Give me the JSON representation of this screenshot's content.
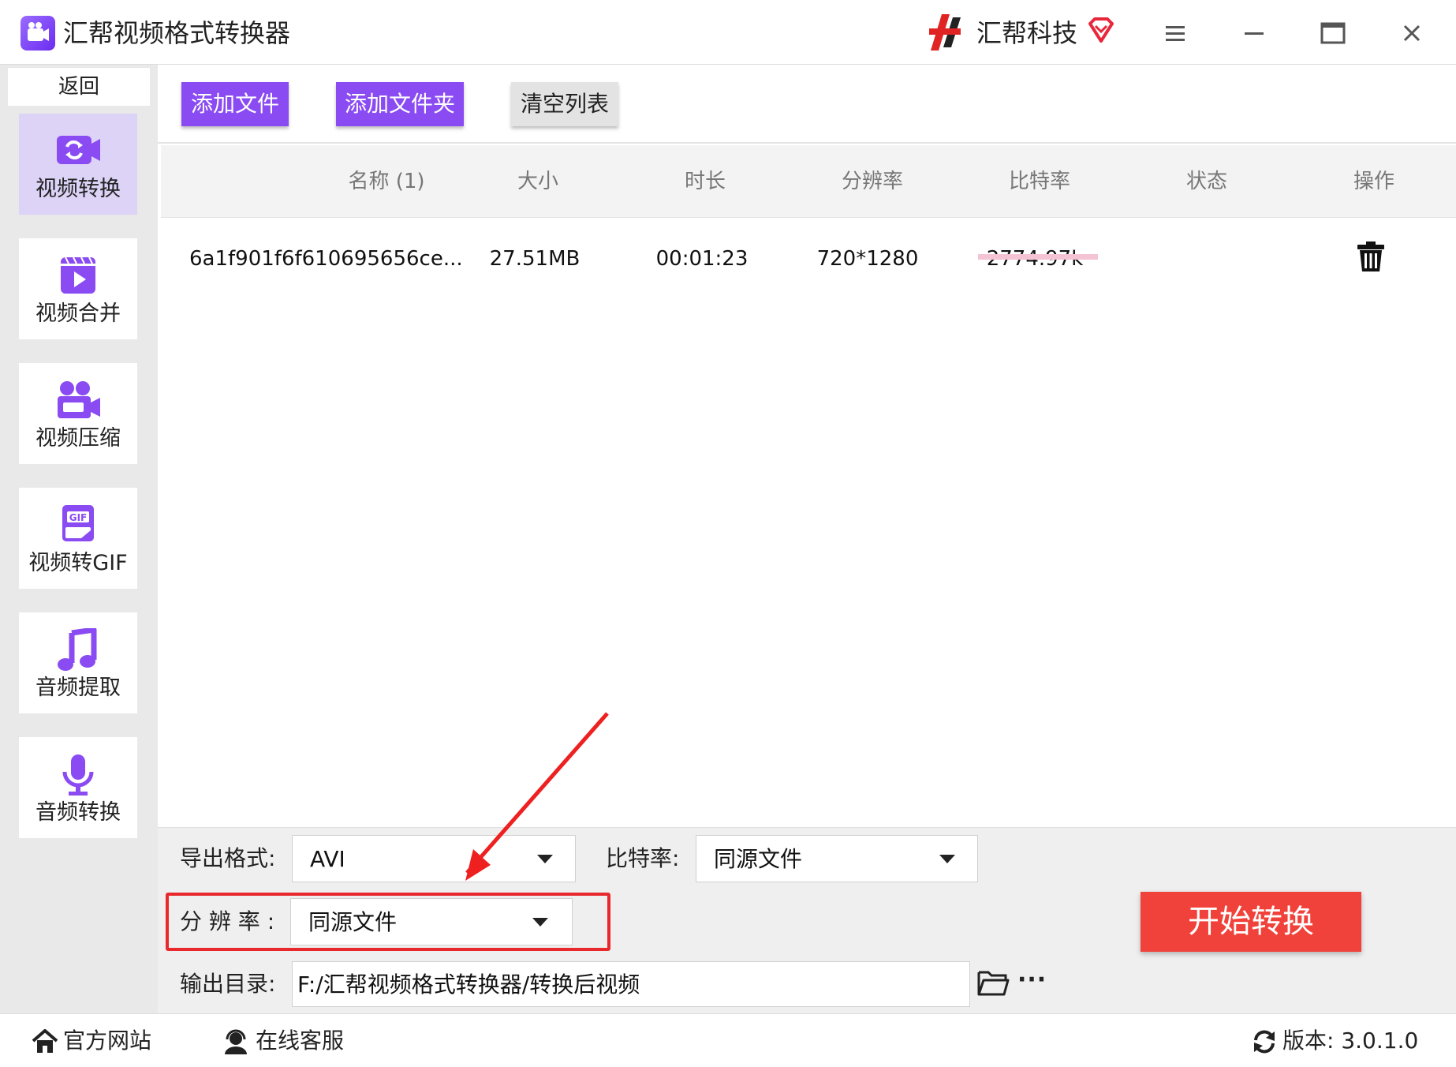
{
  "window": {
    "title": "汇帮视频格式转换器",
    "brand": "汇帮科技"
  },
  "sidebar": {
    "back_label": "返回",
    "items": [
      {
        "label": "视频转换",
        "icon": "video-convert-icon",
        "active": true
      },
      {
        "label": "视频合并",
        "icon": "video-merge-icon",
        "active": false
      },
      {
        "label": "视频压缩",
        "icon": "video-compress-icon",
        "active": false
      },
      {
        "label": "视频转GIF",
        "icon": "gif-icon",
        "active": false
      },
      {
        "label": "音频提取",
        "icon": "music-note-icon",
        "active": false
      },
      {
        "label": "音频转换",
        "icon": "microphone-icon",
        "active": false
      }
    ]
  },
  "toolbar": {
    "add_file": "添加文件",
    "add_folder": "添加文件夹",
    "clear_list": "清空列表"
  },
  "table": {
    "headers": [
      "名称 (1)",
      "大小",
      "时长",
      "分辨率",
      "比特率",
      "状态",
      "操作"
    ],
    "rows": [
      {
        "name": "6a1f901f6f610695656ce...",
        "size": "27.51MB",
        "duration": "00:01:23",
        "resolution": "720*1280",
        "bitrate": "2774.97k",
        "progress": 0
      }
    ]
  },
  "settings": {
    "format_label": "导出格式:",
    "format_value": "AVI",
    "bitrate_label": "比特率:",
    "bitrate_value": "同源文件",
    "resolution_label": "分 辨 率 :",
    "resolution_value": "同源文件",
    "output_label": "输出目录:",
    "output_path": "F:/汇帮视频格式转换器/转换后视频",
    "more": "···",
    "start_button": "开始转换"
  },
  "footer": {
    "website": "官方网站",
    "support": "在线客服",
    "version": "版本: 3.0.1.0"
  },
  "colors": {
    "accent": "#8a4bf2",
    "sidebar_active": "#ddd3f7",
    "start": "#f0423a",
    "highlight": "#e8282c"
  }
}
